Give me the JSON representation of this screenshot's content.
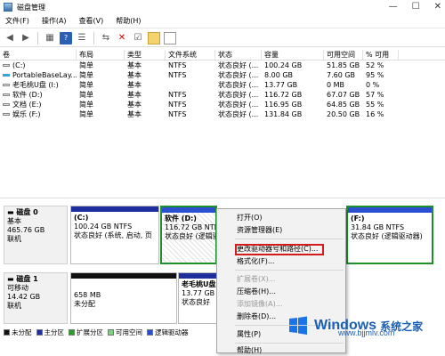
{
  "window": {
    "title": "磁盘管理"
  },
  "menu": [
    "文件(F)",
    "操作(A)",
    "查看(V)",
    "帮助(H)"
  ],
  "toolbar": [
    "back-icon",
    "forward-icon",
    "grid-icon",
    "help-icon",
    "list-icon",
    "connect-icon",
    "delete-icon",
    "check-icon",
    "folder-icon",
    "document-icon"
  ],
  "volumes": {
    "headers": [
      "卷",
      "布局",
      "类型",
      "文件系统",
      "状态",
      "容量",
      "可用空间",
      "% 可用"
    ],
    "rows": [
      [
        "(C:)",
        "简单",
        "基本",
        "NTFS",
        "状态良好 (...",
        "100.24 GB",
        "51.85 GB",
        "52 %"
      ],
      [
        "PortableBaseLay...",
        "简单",
        "基本",
        "NTFS",
        "状态良好 (...",
        "8.00 GB",
        "7.60 GB",
        "95 %"
      ],
      [
        "老毛桃U盘 (I:)",
        "简单",
        "基本",
        "",
        "状态良好 (...",
        "13.77 GB",
        "0 MB",
        "0 %"
      ],
      [
        "软件 (D:)",
        "简单",
        "基本",
        "NTFS",
        "状态良好 (...",
        "116.72 GB",
        "67.07 GB",
        "57 %"
      ],
      [
        "文档 (E:)",
        "简单",
        "基本",
        "NTFS",
        "状态良好 (...",
        "116.95 GB",
        "64.85 GB",
        "55 %"
      ],
      [
        "娱乐 (F:)",
        "简单",
        "基本",
        "NTFS",
        "状态良好 (...",
        "131.84 GB",
        "20.50 GB",
        "16 %"
      ]
    ]
  },
  "disk0": {
    "name": "磁盘 0",
    "type": "基本",
    "size": "465.76 GB",
    "status": "联机",
    "c": {
      "name": "(C:)",
      "size": "100.24 GB NTFS",
      "status": "状态良好 (系统, 启动, 页"
    },
    "d": {
      "name": "软件 (D:)",
      "size": "116.72 GB NTFS",
      "status": "状态良好 (逻辑驱"
    },
    "f": {
      "name": "(F:)",
      "size": "31.84 GB NTFS",
      "status": "状态良好 (逻辑驱动器)"
    }
  },
  "disk1": {
    "name": "磁盘 1",
    "type": "可移动",
    "size": "14.42 GB",
    "status": "联机",
    "p1": {
      "size": "658 MB",
      "status": "未分配"
    },
    "p2": {
      "name": "老毛桃U盘 (",
      "size": "13.77 GB",
      "status": "状态良好"
    }
  },
  "legend": [
    {
      "label": "未分配",
      "color": "#111111"
    },
    {
      "label": "主分区",
      "color": "#1e2f9d"
    },
    {
      "label": "扩展分区",
      "color": "#2e9b2e"
    },
    {
      "label": "可用空间",
      "color": "#7fd17f"
    },
    {
      "label": "逻辑驱动器",
      "color": "#2a4fd1"
    }
  ],
  "context_menu": {
    "open": "打开(O)",
    "explore": "资源管理器(E)",
    "change_letter": "更改驱动器号和路径(C)...",
    "format": "格式化(F)...",
    "extend": "扩展卷(X)...",
    "shrink": "压缩卷(H)...",
    "mirror": "添加镜像(A)...",
    "delete": "删除卷(D)...",
    "properties": "属性(P)",
    "help": "帮助(H)"
  },
  "watermark": {
    "brand": "Windows",
    "cn": "系统之家",
    "url": "www.bjjmlv.com"
  }
}
